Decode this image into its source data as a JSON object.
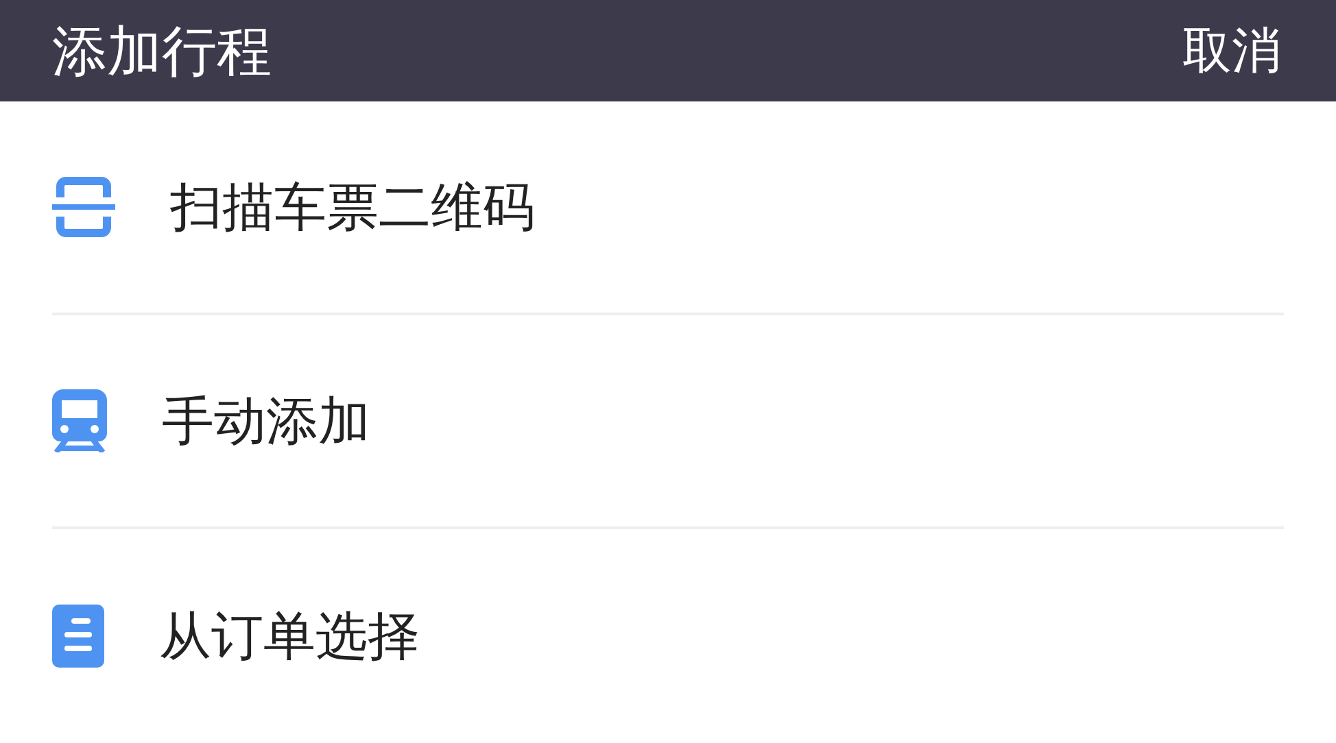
{
  "header": {
    "title": "添加行程",
    "cancel": "取消"
  },
  "options": [
    {
      "kind": "scan",
      "label": "扫描车票二维码"
    },
    {
      "kind": "train",
      "label": "手动添加"
    },
    {
      "kind": "document",
      "label": "从订单选择"
    }
  ]
}
